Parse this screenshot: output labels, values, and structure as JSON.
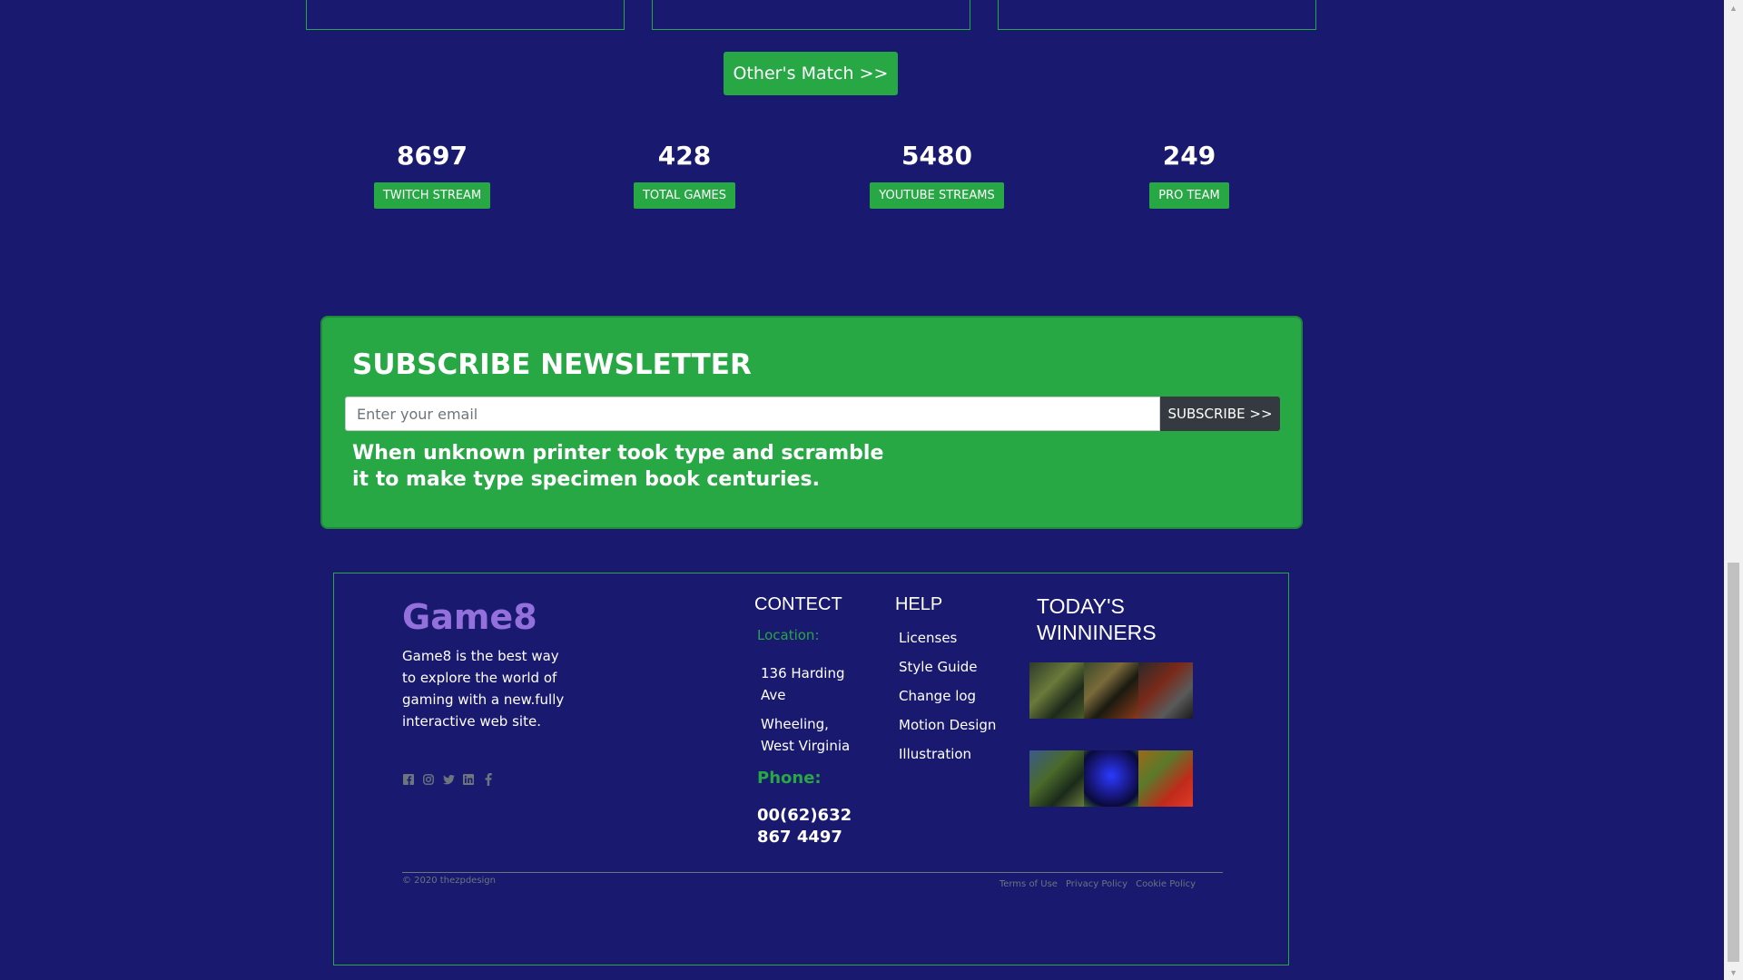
{
  "match_button": {
    "label": "Other's Match >>"
  },
  "stats": [
    {
      "value": "8697",
      "label": "TWITCH STREAM"
    },
    {
      "value": "428",
      "label": "TOTAL GAMES"
    },
    {
      "value": "5480",
      "label": "YOUTUBE STREAMS"
    },
    {
      "value": "249",
      "label": "PRO TEAM"
    }
  ],
  "newsletter": {
    "title": "SUBSCRIBE NEWSLETTER",
    "email_placeholder": "Enter your email",
    "button_label": "SUBSCRIBE >>",
    "text": "When unknown printer took type and scramble it to make type specimen book centuries."
  },
  "footer": {
    "brand": "Game8",
    "description": "Game8 is the best way to explore the world of gaming with a new.fully interactive web site.",
    "social_icons": [
      "facebook-square-icon",
      "instagram-icon",
      "twitter-icon",
      "linkedin-icon",
      "facebook-icon"
    ],
    "contact": {
      "title": "CONTECT",
      "location_label": "Location:",
      "address_line1": "136 Harding Ave",
      "address_line2": "Wheeling, West Virginia",
      "phone_label": "Phone:",
      "phone": "00(62)632 867 4497"
    },
    "help": {
      "title": "HELP",
      "items": [
        "Licenses",
        "Style Guide",
        "Change log",
        "Motion Design",
        "Illustration"
      ]
    },
    "winners": {
      "title": "TODAY'S WINNINERS"
    },
    "copyright": "© 2020 thezpdesign",
    "legal_links": [
      "Terms of Use",
      "Privacy Policy",
      "Cookie Policy"
    ]
  },
  "colors": {
    "background": "#191970",
    "accent_green": "#28a745",
    "brand_purple": "#9370db",
    "dark_button": "#343a40"
  }
}
